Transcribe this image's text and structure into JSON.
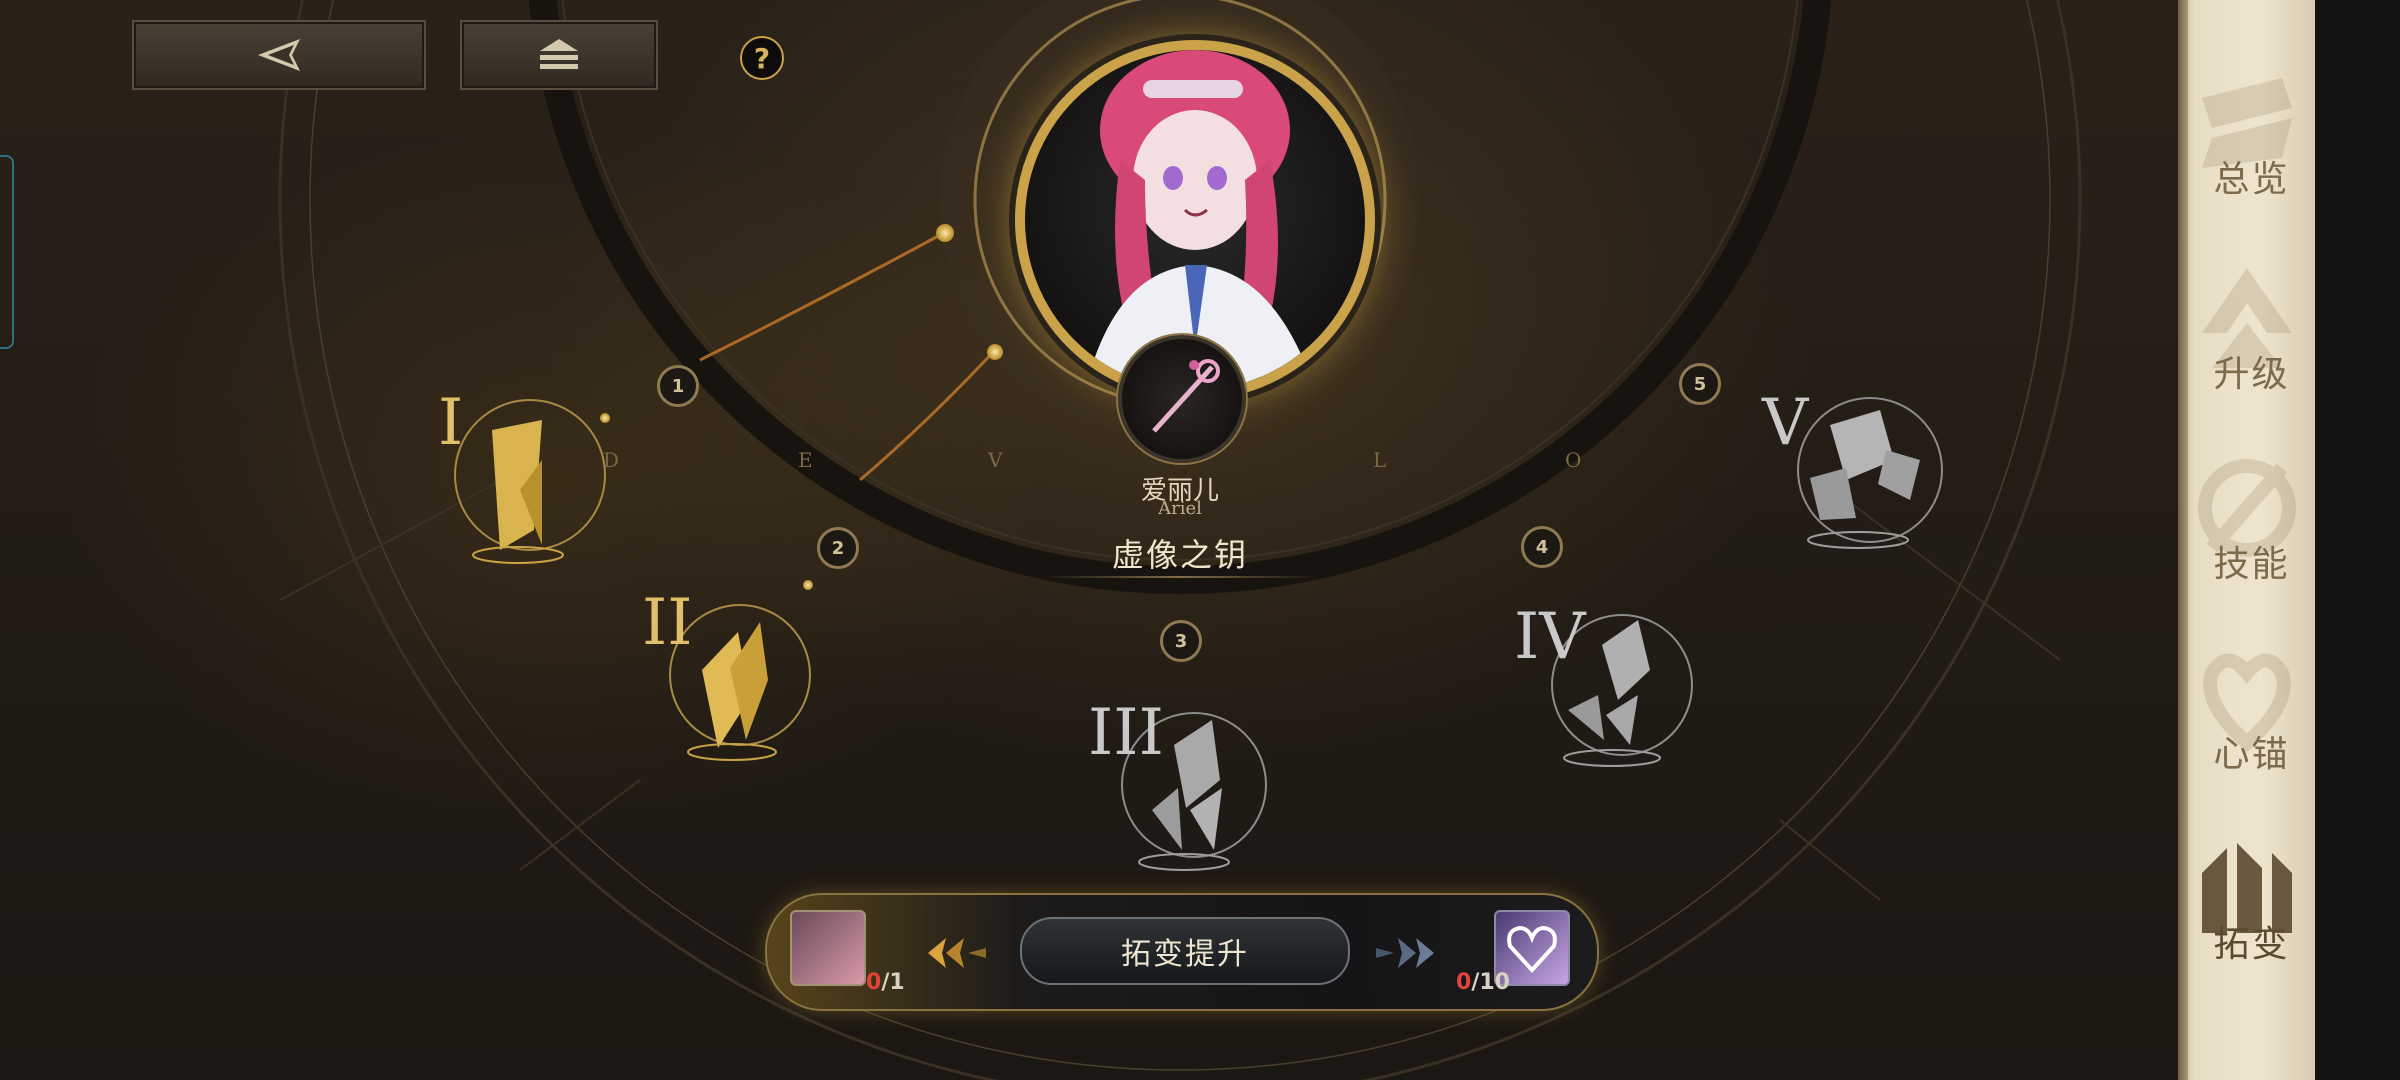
{
  "top_bar": {
    "back_icon": "back-arrow-icon",
    "home_icon": "home-stack-icon",
    "help_label": "?"
  },
  "character": {
    "name_cn": "爱丽儿",
    "name_en": "Ariel",
    "weapon_title": "虚像之钥"
  },
  "track": {
    "letters": [
      "D",
      "E",
      "V",
      "L",
      "O"
    ],
    "nodes": [
      "1",
      "2",
      "3",
      "4",
      "5"
    ]
  },
  "stages": [
    {
      "roman": "I",
      "state": "unlocked"
    },
    {
      "roman": "II",
      "state": "unlocked"
    },
    {
      "roman": "III",
      "state": "locked"
    },
    {
      "roman": "IV",
      "state": "locked"
    },
    {
      "roman": "V",
      "state": "locked"
    }
  ],
  "bottom": {
    "upgrade_label": "拓变提升",
    "left_item": {
      "current": "0",
      "required": "/1"
    },
    "right_item": {
      "current": "0",
      "required": "/10"
    }
  },
  "sidebar": {
    "items": [
      {
        "label": "总览",
        "icon": "overview-icon"
      },
      {
        "label": "升级",
        "icon": "level-up-icon"
      },
      {
        "label": "技能",
        "icon": "skill-icon"
      },
      {
        "label": "心锚",
        "icon": "heart-anchor-icon"
      },
      {
        "label": "拓变",
        "icon": "transform-icon",
        "active": true
      }
    ]
  },
  "colors": {
    "gold": "#c9a24a",
    "silver": "#b8b8b8",
    "accent_red": "#e0443c"
  }
}
